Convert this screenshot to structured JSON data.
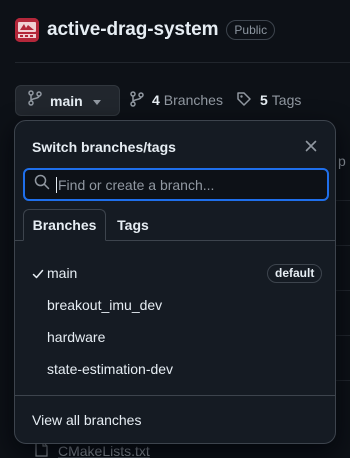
{
  "repo": {
    "name": "active-drag-system",
    "visibility": "Public",
    "avatar_color": "#b3273a"
  },
  "toolbar": {
    "branch_label": "main",
    "branches_count": "4",
    "branches_word": "Branches",
    "tags_count": "5",
    "tags_word": "Tags"
  },
  "background": {
    "partial_text": "p",
    "file_name": "CMakeLists.txt"
  },
  "dropdown": {
    "title": "Switch branches/tags",
    "search_placeholder": "Find or create a branch...",
    "tabs": [
      {
        "label": "Branches",
        "active": true
      },
      {
        "label": "Tags",
        "active": false
      }
    ],
    "branches": [
      {
        "name": "main",
        "selected": true,
        "badge": "default"
      },
      {
        "name": "breakout_imu_dev",
        "selected": false
      },
      {
        "name": "hardware",
        "selected": false
      },
      {
        "name": "state-estimation-dev",
        "selected": false
      }
    ],
    "footer_link": "View all branches"
  },
  "colors": {
    "background": "#0d1117",
    "panel": "#151b23",
    "focus_border": "#1f6feb",
    "muted_text": "#9198a1"
  },
  "icons": {
    "avatar": "repo-avatar-icon",
    "branch": "git-branch-icon",
    "caret": "triangle-down-icon",
    "tag": "tag-icon",
    "close": "x-icon",
    "search": "search-icon",
    "check": "check-icon",
    "file": "file-icon"
  }
}
